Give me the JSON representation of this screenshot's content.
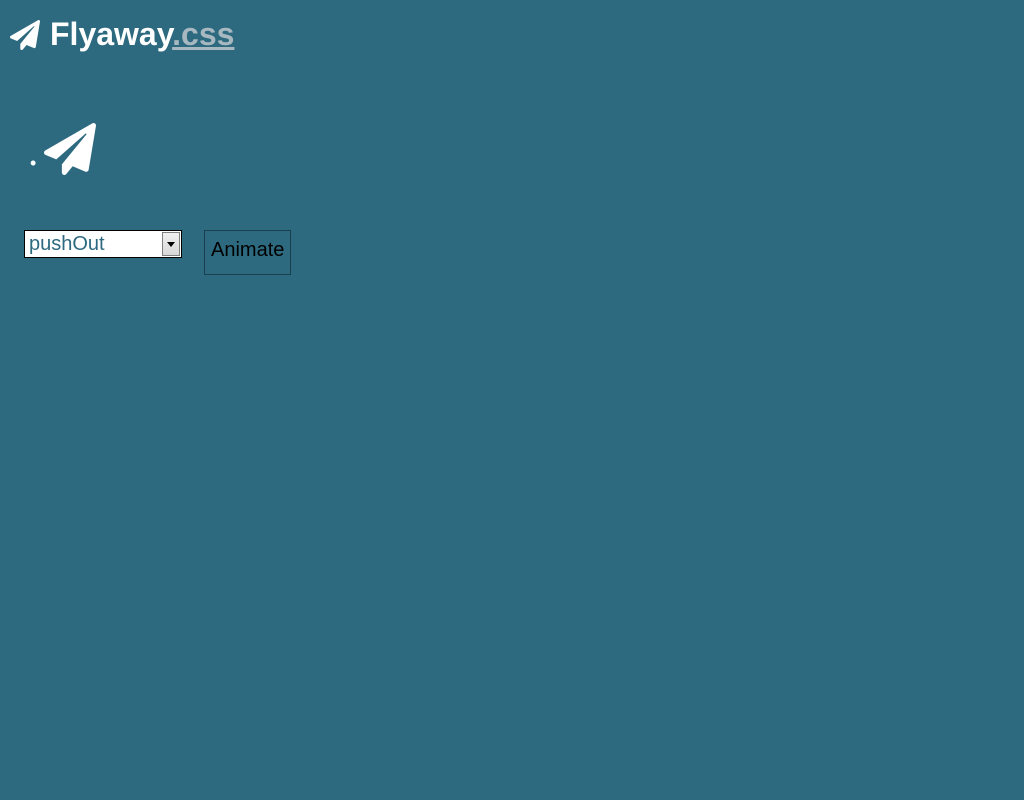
{
  "header": {
    "title_main": "Flyaway",
    "title_suffix": ".css"
  },
  "controls": {
    "select_value": "pushOut",
    "animate_label": "Animate"
  }
}
